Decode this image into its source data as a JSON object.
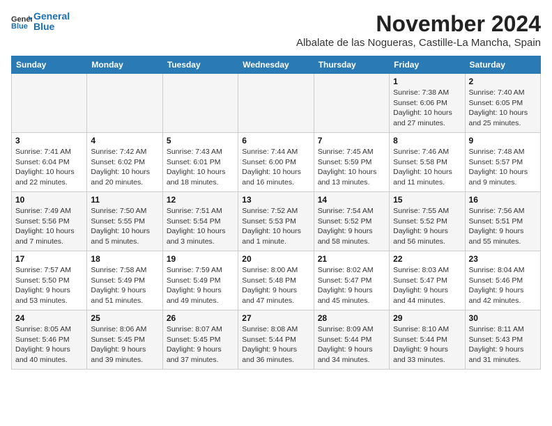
{
  "logo": {
    "line1": "General",
    "line2": "Blue"
  },
  "title": "November 2024",
  "location": "Albalate de las Nogueras, Castille-La Mancha, Spain",
  "weekdays": [
    "Sunday",
    "Monday",
    "Tuesday",
    "Wednesday",
    "Thursday",
    "Friday",
    "Saturday"
  ],
  "weeks": [
    [
      {
        "day": "",
        "info": ""
      },
      {
        "day": "",
        "info": ""
      },
      {
        "day": "",
        "info": ""
      },
      {
        "day": "",
        "info": ""
      },
      {
        "day": "",
        "info": ""
      },
      {
        "day": "1",
        "info": "Sunrise: 7:38 AM\nSunset: 6:06 PM\nDaylight: 10 hours and 27 minutes."
      },
      {
        "day": "2",
        "info": "Sunrise: 7:40 AM\nSunset: 6:05 PM\nDaylight: 10 hours and 25 minutes."
      }
    ],
    [
      {
        "day": "3",
        "info": "Sunrise: 7:41 AM\nSunset: 6:04 PM\nDaylight: 10 hours and 22 minutes."
      },
      {
        "day": "4",
        "info": "Sunrise: 7:42 AM\nSunset: 6:02 PM\nDaylight: 10 hours and 20 minutes."
      },
      {
        "day": "5",
        "info": "Sunrise: 7:43 AM\nSunset: 6:01 PM\nDaylight: 10 hours and 18 minutes."
      },
      {
        "day": "6",
        "info": "Sunrise: 7:44 AM\nSunset: 6:00 PM\nDaylight: 10 hours and 16 minutes."
      },
      {
        "day": "7",
        "info": "Sunrise: 7:45 AM\nSunset: 5:59 PM\nDaylight: 10 hours and 13 minutes."
      },
      {
        "day": "8",
        "info": "Sunrise: 7:46 AM\nSunset: 5:58 PM\nDaylight: 10 hours and 11 minutes."
      },
      {
        "day": "9",
        "info": "Sunrise: 7:48 AM\nSunset: 5:57 PM\nDaylight: 10 hours and 9 minutes."
      }
    ],
    [
      {
        "day": "10",
        "info": "Sunrise: 7:49 AM\nSunset: 5:56 PM\nDaylight: 10 hours and 7 minutes."
      },
      {
        "day": "11",
        "info": "Sunrise: 7:50 AM\nSunset: 5:55 PM\nDaylight: 10 hours and 5 minutes."
      },
      {
        "day": "12",
        "info": "Sunrise: 7:51 AM\nSunset: 5:54 PM\nDaylight: 10 hours and 3 minutes."
      },
      {
        "day": "13",
        "info": "Sunrise: 7:52 AM\nSunset: 5:53 PM\nDaylight: 10 hours and 1 minute."
      },
      {
        "day": "14",
        "info": "Sunrise: 7:54 AM\nSunset: 5:52 PM\nDaylight: 9 hours and 58 minutes."
      },
      {
        "day": "15",
        "info": "Sunrise: 7:55 AM\nSunset: 5:52 PM\nDaylight: 9 hours and 56 minutes."
      },
      {
        "day": "16",
        "info": "Sunrise: 7:56 AM\nSunset: 5:51 PM\nDaylight: 9 hours and 55 minutes."
      }
    ],
    [
      {
        "day": "17",
        "info": "Sunrise: 7:57 AM\nSunset: 5:50 PM\nDaylight: 9 hours and 53 minutes."
      },
      {
        "day": "18",
        "info": "Sunrise: 7:58 AM\nSunset: 5:49 PM\nDaylight: 9 hours and 51 minutes."
      },
      {
        "day": "19",
        "info": "Sunrise: 7:59 AM\nSunset: 5:49 PM\nDaylight: 9 hours and 49 minutes."
      },
      {
        "day": "20",
        "info": "Sunrise: 8:00 AM\nSunset: 5:48 PM\nDaylight: 9 hours and 47 minutes."
      },
      {
        "day": "21",
        "info": "Sunrise: 8:02 AM\nSunset: 5:47 PM\nDaylight: 9 hours and 45 minutes."
      },
      {
        "day": "22",
        "info": "Sunrise: 8:03 AM\nSunset: 5:47 PM\nDaylight: 9 hours and 44 minutes."
      },
      {
        "day": "23",
        "info": "Sunrise: 8:04 AM\nSunset: 5:46 PM\nDaylight: 9 hours and 42 minutes."
      }
    ],
    [
      {
        "day": "24",
        "info": "Sunrise: 8:05 AM\nSunset: 5:46 PM\nDaylight: 9 hours and 40 minutes."
      },
      {
        "day": "25",
        "info": "Sunrise: 8:06 AM\nSunset: 5:45 PM\nDaylight: 9 hours and 39 minutes."
      },
      {
        "day": "26",
        "info": "Sunrise: 8:07 AM\nSunset: 5:45 PM\nDaylight: 9 hours and 37 minutes."
      },
      {
        "day": "27",
        "info": "Sunrise: 8:08 AM\nSunset: 5:44 PM\nDaylight: 9 hours and 36 minutes."
      },
      {
        "day": "28",
        "info": "Sunrise: 8:09 AM\nSunset: 5:44 PM\nDaylight: 9 hours and 34 minutes."
      },
      {
        "day": "29",
        "info": "Sunrise: 8:10 AM\nSunset: 5:44 PM\nDaylight: 9 hours and 33 minutes."
      },
      {
        "day": "30",
        "info": "Sunrise: 8:11 AM\nSunset: 5:43 PM\nDaylight: 9 hours and 31 minutes."
      }
    ]
  ]
}
